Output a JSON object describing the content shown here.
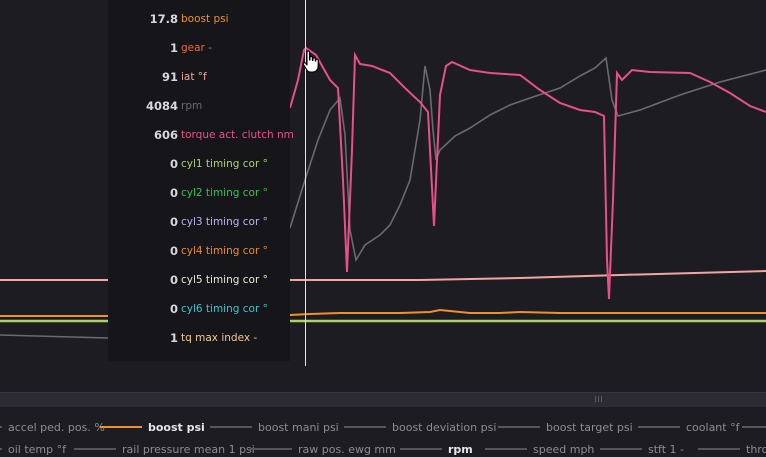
{
  "tooltip": {
    "rows": [
      {
        "value": "17.8",
        "label": "boost psi",
        "color": "#f0902a"
      },
      {
        "value": "1",
        "label": "gear -",
        "color": "#ef6a3a"
      },
      {
        "value": "91",
        "label": "iat °f",
        "color": "#f4a5a0"
      },
      {
        "value": "4084",
        "label": "rpm",
        "color": "#6a6a72"
      },
      {
        "value": "606",
        "label": "torque act. clutch nm",
        "color": "#e7508a"
      },
      {
        "value": "0",
        "label": "cyl1 timing cor °",
        "color": "#a9d465"
      },
      {
        "value": "0",
        "label": "cyl2 timing cor °",
        "color": "#39c24a"
      },
      {
        "value": "0",
        "label": "cyl3 timing cor °",
        "color": "#b9b4f2"
      },
      {
        "value": "0",
        "label": "cyl4 timing cor °",
        "color": "#ef8a2a"
      },
      {
        "value": "0",
        "label": "cyl5 timing cor °",
        "color": "#e8e8d8"
      },
      {
        "value": "0",
        "label": "cyl6 timing cor °",
        "color": "#36c7d2"
      },
      {
        "value": "1",
        "label": "tq max index -",
        "color": "#f4c890"
      }
    ]
  },
  "legend": {
    "row1": [
      {
        "label": "accel ped. pos. %",
        "color": "#55555c",
        "active": false
      },
      {
        "label": "boost psi",
        "color": "#f0902a",
        "active": true
      },
      {
        "label": "boost mani psi",
        "color": "#55555c",
        "active": false
      },
      {
        "label": "boost deviation psi",
        "color": "#55555c",
        "active": false
      },
      {
        "label": "boost target psi",
        "color": "#55555c",
        "active": false
      },
      {
        "label": "coolant °f",
        "color": "#55555c",
        "active": false
      },
      {
        "label": "",
        "color": "#55555c",
        "active": false
      }
    ],
    "row2": [
      {
        "label": "oil temp °f",
        "color": "#55555c",
        "active": false
      },
      {
        "label": "rail pressure mean 1 psi",
        "color": "#55555c",
        "active": false
      },
      {
        "label": "raw pos. ewg mm",
        "color": "#55555c",
        "active": false
      },
      {
        "label": "rpm",
        "color": "#55555c",
        "active": true
      },
      {
        "label": "speed mph",
        "color": "#55555c",
        "active": false
      },
      {
        "label": "stft 1 -",
        "color": "#55555c",
        "active": false
      },
      {
        "label": "throt",
        "color": "#55555c",
        "active": false
      }
    ]
  },
  "colors": {
    "torque": "#e7508a",
    "rpm": "#6a6a72",
    "boost": "#f0902a",
    "iat": "#f4a5a0",
    "timing": "#a9d465"
  }
}
